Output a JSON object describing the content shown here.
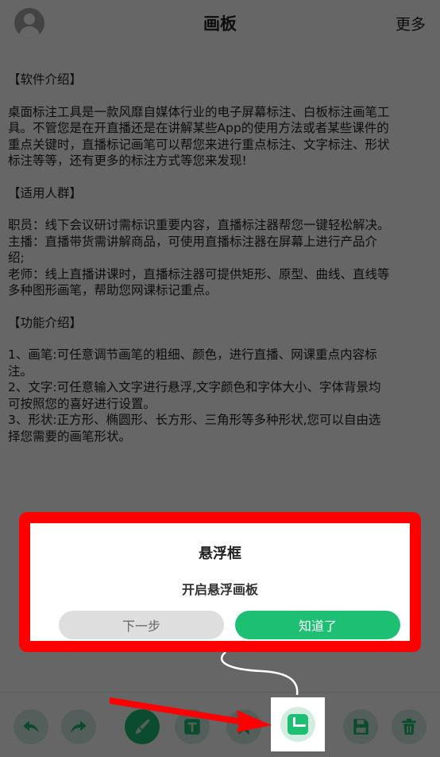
{
  "header": {
    "title": "画板",
    "more": "更多"
  },
  "content": [
    {
      "lines": [
        "【软件介绍】"
      ]
    },
    {
      "lines": [
        "桌面标注工具是一款风靡自媒体行业的电子屏幕标注、白板标注画笔工",
        "具。不管您是在开直播还是在讲解某些App的使用方法或者某些课件的",
        "重点关键时，直播标记画笔可以帮您来进行重点标注、文字标注、形状",
        "标注等等，还有更多的标注方式等您来发现!"
      ]
    },
    {
      "lines": [
        "【适用人群】"
      ]
    },
    {
      "lines": [
        "职员：线下会议研讨需标识重要内容，直播标注器帮您一键轻松解决。",
        "主播：直播带货需讲解商品，可使用直播标注器在屏幕上进行产品介",
        "绍;",
        "老师：线上直播讲课时，直播标注器可提供矩形、原型、曲线、直线等",
        "多种图形画笔，帮助您网课标记重点。"
      ]
    },
    {
      "lines": [
        "【功能介绍】"
      ]
    },
    {
      "lines": [
        "1、画笔:可任意调节画笔的粗细、颜色，进行直播、网课重点内容标",
        "注。",
        "2、文字:可任意输入文字进行悬浮,文字颜色和字体大小、字体背景均",
        "可按照您的喜好进行设置。",
        "3、形状:正方形、椭圆形、长方形、三角形等多种形状,您可以自由选",
        "择您需要的画笔形状。"
      ]
    }
  ],
  "tip": {
    "title": "悬浮框",
    "message": "开启悬浮画板",
    "next": "下一步",
    "ok": "知道了"
  },
  "toolbar": {
    "items": [
      "undo-icon",
      "redo-icon",
      "brush-icon",
      "text-icon",
      "bookmark-icon",
      "float-board-icon",
      "save-icon",
      "delete-icon"
    ]
  },
  "colors": {
    "accent": "#1dbf73",
    "highlight_frame": "#ff0000",
    "overlay": "rgba(0,0,0,0.60)"
  }
}
